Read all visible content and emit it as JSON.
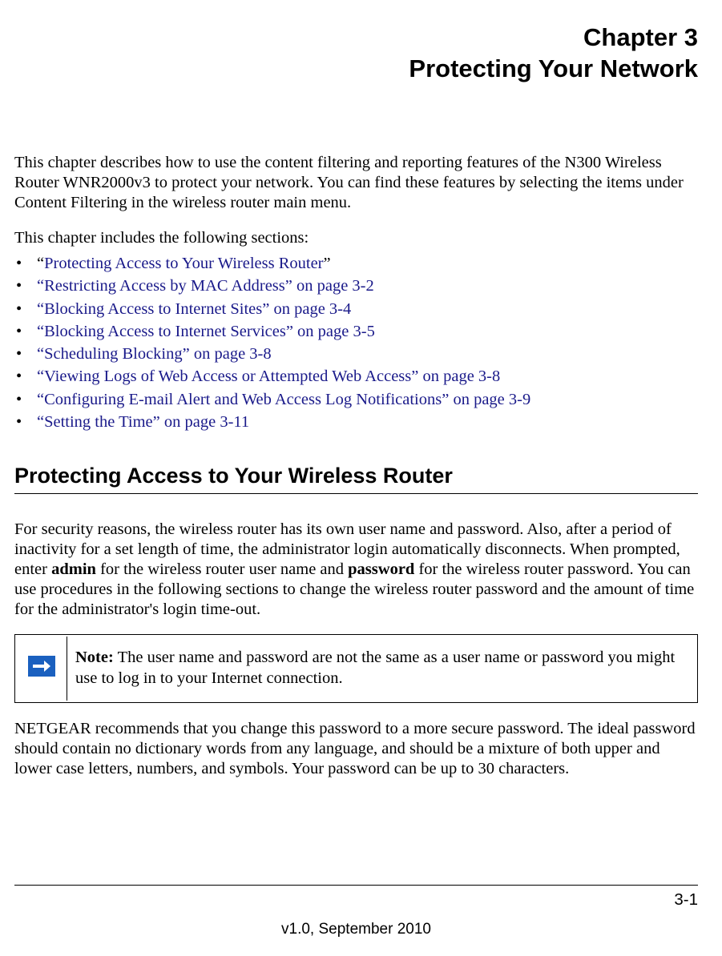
{
  "chapter": {
    "number_line": "Chapter 3",
    "title_line": "Protecting Your Network"
  },
  "intro": "This chapter describes how to use the content filtering and reporting features of the N300 Wireless Router WNR2000v3 to protect your network. You can find these features by selecting the items under Content Filtering in the wireless router main menu.",
  "sections_intro": "This chapter includes the following sections:",
  "toc": [
    {
      "prefix": "“",
      "link": "Protecting Access to Your Wireless Router",
      "suffix": "”"
    },
    {
      "prefix": "",
      "link": "“Restricting Access by MAC Address” on page 3-2",
      "suffix": ""
    },
    {
      "prefix": "",
      "link": "“Blocking Access to Internet Sites” on page 3-4",
      "suffix": ""
    },
    {
      "prefix": "",
      "link": "“Blocking Access to Internet Services” on page 3-5",
      "suffix": ""
    },
    {
      "prefix": "",
      "link": "“Scheduling Blocking” on page 3-8",
      "suffix": ""
    },
    {
      "prefix": "",
      "link": "“Viewing Logs of Web Access or Attempted Web Access” on page 3-8",
      "suffix": ""
    },
    {
      "prefix": "",
      "link": "“Configuring E-mail Alert and Web Access Log Notifications” on page 3-9",
      "suffix": ""
    },
    {
      "prefix": "",
      "link": "“Setting the Time” on page 3-11",
      "suffix": ""
    }
  ],
  "section1": {
    "heading": "Protecting Access to Your Wireless Router",
    "para1_pre": "For security reasons, the wireless router has its own user name and password. Also, after a period of inactivity for a set length of time, the administrator login automatically disconnects. When prompted, enter ",
    "para1_bold1": "admin",
    "para1_mid": " for the wireless router user name and ",
    "para1_bold2": "password",
    "para1_post": " for the wireless router password. You can use procedures in the following sections to change the wireless router password and the amount of time for the administrator's login time-out.",
    "note_label": "Note:",
    "note_text": " The user name and password are not the same as a user name or password you might use to log in to your Internet connection.",
    "para2": "NETGEAR recommends that you change this password to a more secure password. The ideal password should contain no dictionary words from any language, and should be a mixture of both upper and lower case letters, numbers, and symbols. Your password can be up to 30 characters."
  },
  "footer": {
    "page_number": "3-1",
    "version": "v1.0, September 2010"
  }
}
